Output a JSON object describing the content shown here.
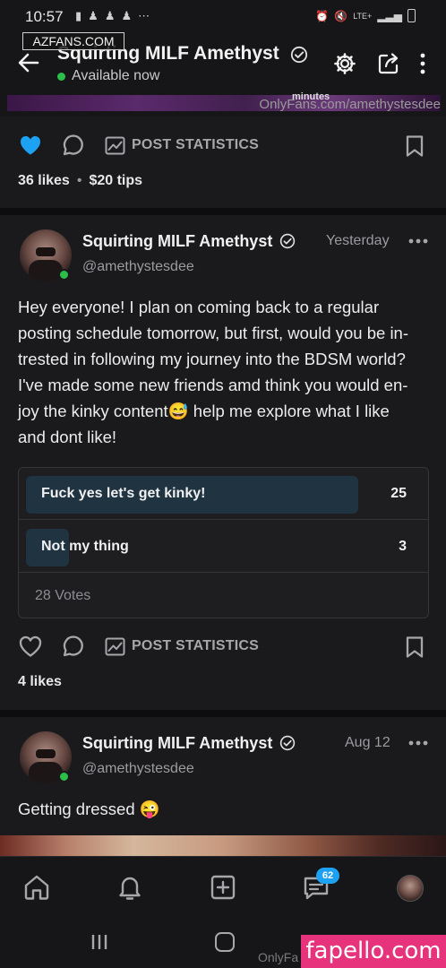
{
  "status_bar": {
    "time": "10:57",
    "left_icons": [
      "message-icon",
      "person-add-icon",
      "person-add-icon",
      "person-add-icon"
    ],
    "more": "⋯",
    "right_text": "LTE+"
  },
  "watermark_top": "AZFANS.COM",
  "header": {
    "name": "Squirting MILF Amethyst",
    "status": "Available now"
  },
  "media_strip": {
    "caption_fragment": "minutes",
    "url_watermark": "OnlyFans.com/amethystesdee"
  },
  "post_prev": {
    "post_statistics": "POST STATISTICS",
    "likes": "36 likes",
    "separator": "•",
    "tips": "$20 tips"
  },
  "post1": {
    "name": "Squirting MILF Amethyst",
    "handle": "@amethystesdee",
    "date": "Yesterday",
    "text_lines": [
      "Hey everyone! I plan on coming back to a regular",
      "posting schedule tomorrow, but first, would you be in-",
      "trested in following my journey into the BDSM world?",
      "I've made some new friends amd think you would en-",
      "joy the kinky content😅 help me explore what I like",
      "and dont like!"
    ],
    "poll": {
      "options": [
        {
          "label": "Fuck yes let's get kinky!",
          "count": "25",
          "fraction": 0.893
        },
        {
          "label": "Not my thing",
          "count": "3",
          "fraction": 0.107
        }
      ],
      "votes": "28 Votes"
    },
    "post_statistics": "POST STATISTICS",
    "likes": "4 likes"
  },
  "post2": {
    "name": "Squirting MILF Amethyst",
    "handle": "@amethystesdee",
    "date": "Aug 12",
    "text": "Getting dressed 😜"
  },
  "bottom_nav": {
    "items": [
      "home-icon",
      "bell-icon",
      "add-post-icon",
      "messages-icon",
      "profile-avatar"
    ],
    "messages_badge": "62"
  },
  "system_nav": {
    "url_watermark": "OnlyFa"
  },
  "watermark_bottom": "fapello.com",
  "colors": {
    "background": "#1a1a1c",
    "accent_blue": "#1da1f2",
    "online_green": "#2bbf4a",
    "poll_fill": "#1f3440",
    "fapello_pink": "#e6337c"
  }
}
